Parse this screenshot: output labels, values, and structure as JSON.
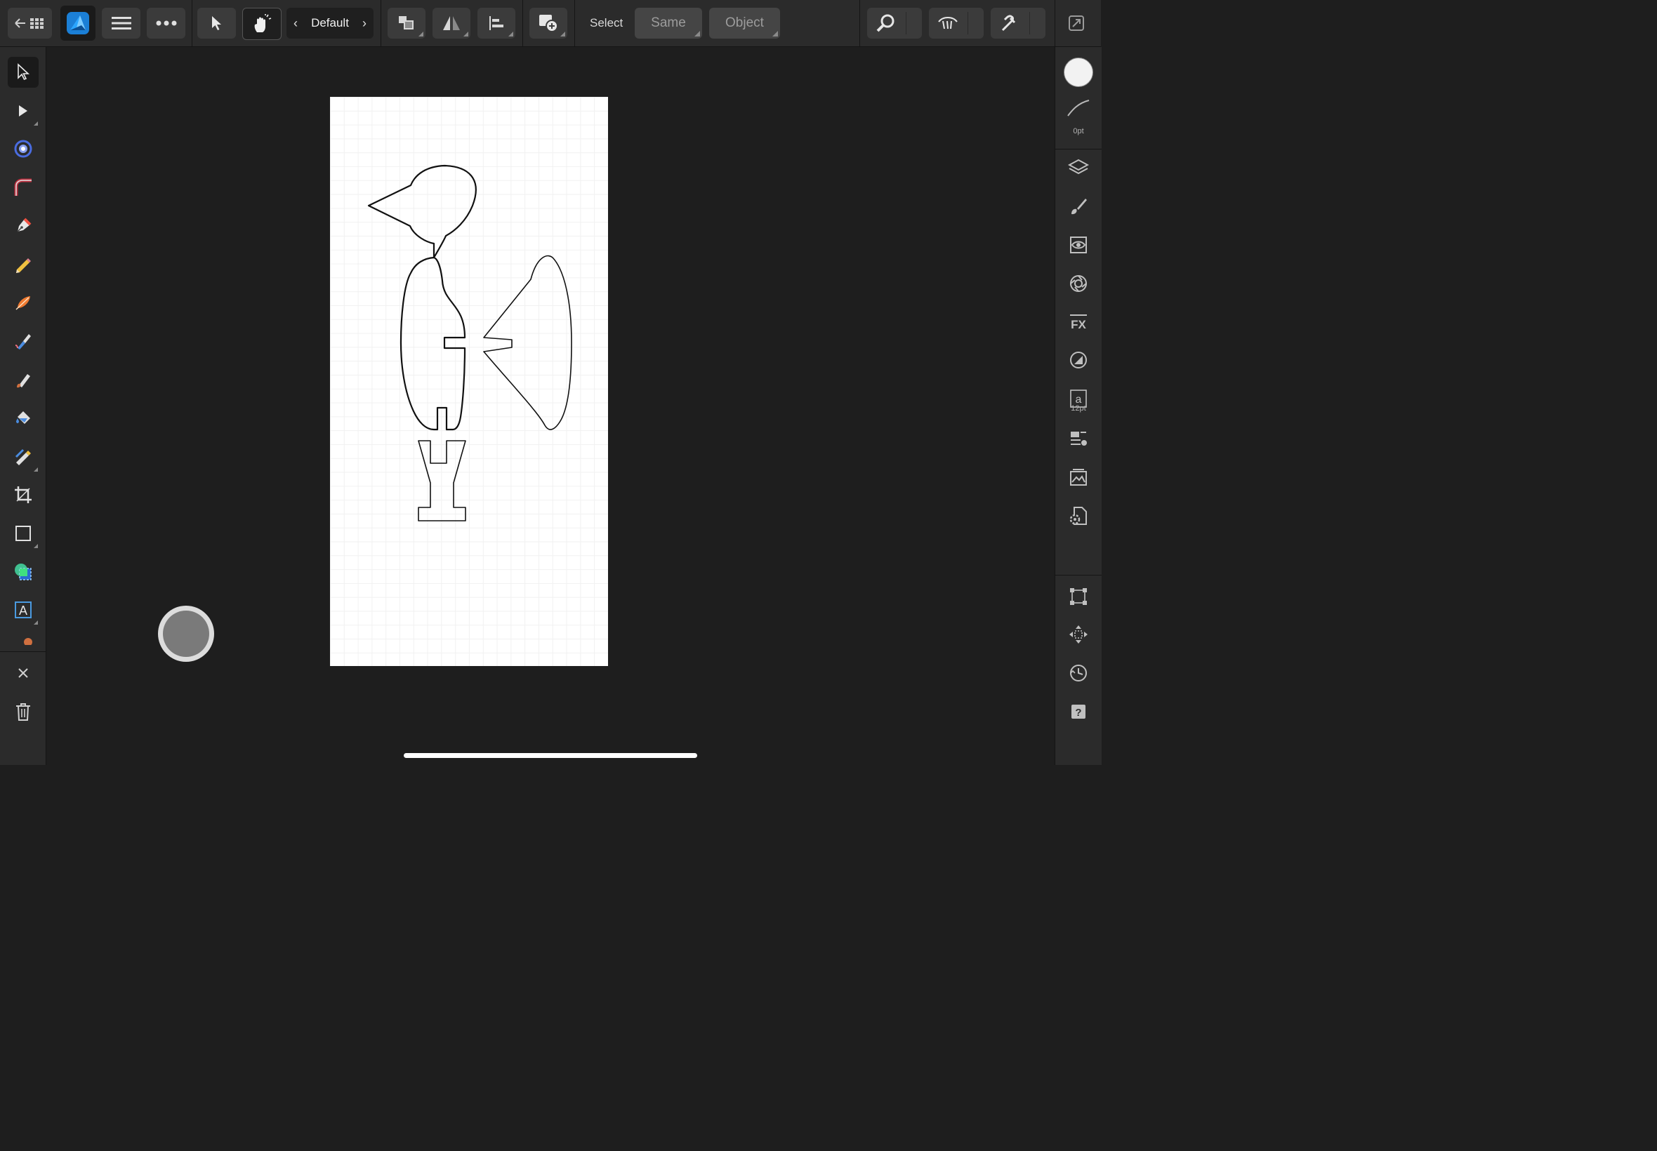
{
  "app": {
    "name": "Affinity Designer",
    "accent_color": "#3aa0f0"
  },
  "toolbar": {
    "back_icon": "back-arrow-grid-icon",
    "app_icon": "affinity-designer-icon",
    "menu_icon": "hamburger-menu-icon",
    "more_icon": "more-dots-icon",
    "move_mode_icon": "arrow-cursor-icon",
    "touch_mode_icon": "hand-tap-icon",
    "preset_label": "Default",
    "arrange_icon": "arrange-icon",
    "flip_icon": "flip-icon",
    "align_icon": "align-icon",
    "add_boolean_icon": "add-shape-icon",
    "select_label": "Select",
    "same_label": "Same",
    "object_label": "Object",
    "zoom_icon": "zoom-icon",
    "view_icon": "view-mode-icon",
    "snap_icon": "snapping-magnet-icon",
    "persona_icon": "persona-switch-icon"
  },
  "tools": [
    {
      "name": "move-tool",
      "icon": "arrow-cursor-icon",
      "selected": true
    },
    {
      "name": "node-tool",
      "icon": "node-cursor-icon"
    },
    {
      "name": "point-transform-tool",
      "icon": "point-transform-icon"
    },
    {
      "name": "corner-tool",
      "icon": "corner-icon"
    },
    {
      "name": "pen-tool",
      "icon": "pen-nib-icon"
    },
    {
      "name": "pencil-tool",
      "icon": "pencil-icon"
    },
    {
      "name": "vector-brush-tool",
      "icon": "vector-brush-icon"
    },
    {
      "name": "fill-tool",
      "icon": "fill-gradient-icon"
    },
    {
      "name": "paint-brush-tool",
      "icon": "paint-brush-icon"
    },
    {
      "name": "flood-fill-tool",
      "icon": "paint-bucket-icon"
    },
    {
      "name": "transparency-tool",
      "icon": "transparency-icon"
    },
    {
      "name": "crop-tool",
      "icon": "crop-icon"
    },
    {
      "name": "rectangle-tool",
      "icon": "rectangle-icon"
    },
    {
      "name": "shape-tool",
      "icon": "shapes-icon"
    },
    {
      "name": "text-tool",
      "icon": "frame-text-icon"
    }
  ],
  "left_bottom": {
    "close_icon": "close-icon",
    "delete_icon": "trash-icon"
  },
  "right_panel": {
    "fill_color": "#f2f2f2",
    "stroke_width_label": "0pt",
    "studio": [
      {
        "name": "layers-studio",
        "icon": "layers-icon"
      },
      {
        "name": "brushes-studio",
        "icon": "brush-icon"
      },
      {
        "name": "appearance-studio",
        "icon": "eye-icon"
      },
      {
        "name": "color-studio",
        "icon": "color-wheel-icon"
      },
      {
        "name": "effects-studio",
        "icon": "fx-icon"
      },
      {
        "name": "transparency-studio",
        "icon": "transparency-circle-icon"
      },
      {
        "name": "text-styles-studio",
        "icon": "text-style-icon"
      },
      {
        "name": "paragraph-studio",
        "icon": "paragraph-icon"
      },
      {
        "name": "assets-studio",
        "icon": "assets-icon"
      },
      {
        "name": "document-settings",
        "icon": "document-gear-icon"
      }
    ],
    "text_size_label": "12pt",
    "bottom_tools": [
      {
        "name": "transform-studio",
        "icon": "transform-box-icon"
      },
      {
        "name": "navigator-studio",
        "icon": "move-arrows-icon"
      },
      {
        "name": "history-studio",
        "icon": "history-clock-icon"
      },
      {
        "name": "help",
        "icon": "help-icon"
      }
    ]
  },
  "canvas": {
    "artboard_color": "#ffffff",
    "modifier_button_icon": "command-controller-icon"
  }
}
